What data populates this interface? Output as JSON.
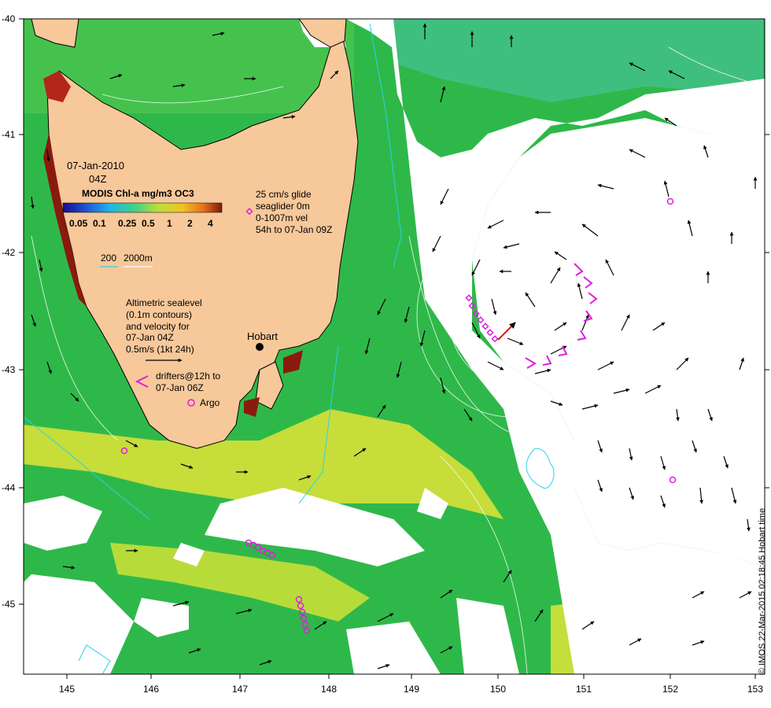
{
  "map": {
    "date": "07-Jan-2010",
    "time": "04Z",
    "chl_title": "MODIS Chl-a mg/m3 OC3",
    "chl_ticks": [
      "0.05",
      "0.1",
      "0.25",
      "0.5",
      "1",
      "2",
      "4"
    ],
    "chl_colors": [
      "#1a0a8c",
      "#1f57d6",
      "#22b6e6",
      "#3fd08a",
      "#b9e13a",
      "#f0c420",
      "#e7731a",
      "#7a1a0b"
    ],
    "depth_legend": {
      "value1": "200",
      "value2": "2000m"
    },
    "glider_note": [
      "25 cm/s glide",
      "seaglider 0m",
      "0-1007m vel",
      "54h to 07-Jan 09Z"
    ],
    "sealevel_note": [
      "Altimetric sealevel",
      "(0.1m contours)",
      "and velocity for",
      "07-Jan 04Z",
      "0.5m/s (1kt 24h)"
    ],
    "drifters_note": [
      "drifters@12h to",
      "07-Jan 06Z"
    ],
    "argo_label": "Argo",
    "place_label": "Hobart",
    "credit": "© IMOS 22-Mar-2015 02:18:45 Hobart time",
    "lon_ticks": [
      "145",
      "146",
      "147",
      "148",
      "149",
      "150",
      "151",
      "152",
      "153"
    ],
    "lat_ticks": [
      "-40",
      "-41",
      "-42",
      "-43",
      "-44",
      "-45"
    ],
    "colors": {
      "land": "#f7c89a",
      "ocean_green": "#2fb84a",
      "ocean_light": "#6fd36a",
      "ocean_cyan": "#3cc9b0",
      "chl_yellow": "#d6e23a",
      "chl_orange": "#e89a2a",
      "chl_red": "#8b1a0e",
      "cloud": "#ffffff",
      "markers": "#e01ee0",
      "isobath": "#29d3e6"
    }
  }
}
